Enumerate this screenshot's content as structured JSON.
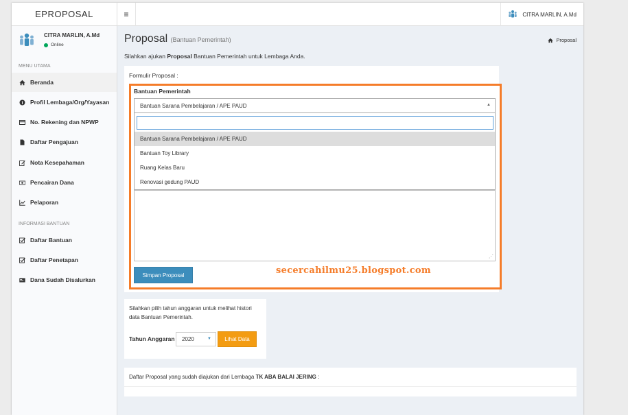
{
  "app": {
    "brand": "EPROPOSAL",
    "menu_toggle_icon": "hamburger-icon"
  },
  "topbar": {
    "user_name": "CITRA MARLIN, A.Md",
    "user_icon": "users-icon"
  },
  "sidebar": {
    "profile": {
      "name": "CITRA MARLIN, A.Md",
      "status": "Online",
      "status_color": "#00a65a"
    },
    "header_main": "MENU UTAMA",
    "header_info": "INFORMASI BANTUAN",
    "items": [
      {
        "label": "Beranda",
        "icon": "home-icon"
      },
      {
        "label": "Profil Lembaga/Org/Yayasan",
        "icon": "info-icon"
      },
      {
        "label": "No. Rekening dan NPWP",
        "icon": "credit-card-icon"
      },
      {
        "label": "Daftar Pengajuan",
        "icon": "file-icon"
      },
      {
        "label": "Nota Kesepahaman",
        "icon": "edit-icon"
      },
      {
        "label": "Pencairan Dana",
        "icon": "money-icon"
      },
      {
        "label": "Pelaporan",
        "icon": "line-chart-icon"
      },
      {
        "label": "Daftar Bantuan",
        "icon": "check-square-icon"
      },
      {
        "label": "Daftar Penetapan",
        "icon": "check-square-icon"
      },
      {
        "label": "Dana Sudah Disalurkan",
        "icon": "card-icon"
      }
    ]
  },
  "page": {
    "title": "Proposal",
    "subtitle": "(Bantuan Pemerintah)",
    "breadcrumb": "Proposal",
    "intro_pre": "Silahkan ajukan ",
    "intro_bold": "Proposal",
    "intro_post": " Bantuan Pemerintah untuk Lembaga Anda."
  },
  "form": {
    "title": "Formulir Proposal :",
    "field_label": "Bantuan Pemerintah",
    "selected": "Bantuan Sarana Pembelajaran / APE PAUD",
    "search_value": "",
    "options": [
      "Bantuan Sarana Pembelajaran / APE PAUD",
      "Bantuan Toy Library",
      "Ruang Kelas Baru",
      "Renovasi gedung PAUD"
    ],
    "save_label": "Simpan Proposal",
    "accent": "#f57c29"
  },
  "watermark": "secercahilmu25.blogspot.com",
  "history": {
    "text": "Silahkan pilih tahun anggaran untuk melihat histori data Bantuan Pemerintah.",
    "label": "Tahun Anggaran",
    "year": "2020",
    "button": "Lihat Data"
  },
  "submitted": {
    "text_pre": "Daftar Proposal yang sudah diajukan dari Lembaga ",
    "lembaga": "TK ABA BALAI JERING",
    "text_post": " :"
  }
}
